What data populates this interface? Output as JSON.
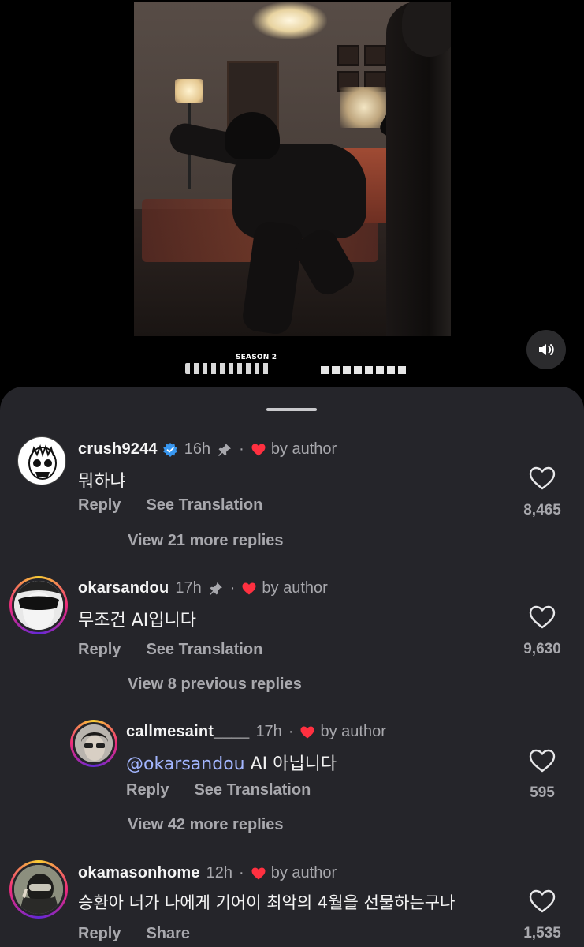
{
  "video": {
    "season_label": "SEASON 2",
    "volume_icon": "speaker-icon"
  },
  "comments": [
    {
      "username": "crush9244",
      "verified": true,
      "time": "16h",
      "pinned": true,
      "separator": "·",
      "by_author": "by author",
      "text": "뭐하냐",
      "reply_label": "Reply",
      "secondary_action": "See Translation",
      "likes": "8,465",
      "view_replies": "View 21 more replies"
    },
    {
      "username": "okarsandou",
      "verified": false,
      "time": "17h",
      "pinned": true,
      "separator": "·",
      "by_author": "by author",
      "text": "무조건 AI입니다",
      "reply_label": "Reply",
      "secondary_action": "See Translation",
      "likes": "9,630",
      "view_previous": "View 8 previous replies",
      "reply": {
        "username": "callmesaint____",
        "time": "17h",
        "separator": "·",
        "by_author": "by author",
        "mention": "@okarsandou",
        "text": " AI 아닙니다",
        "reply_label": "Reply",
        "secondary_action": "See Translation",
        "likes": "595"
      },
      "view_replies": "View 42 more replies"
    },
    {
      "username": "okamasonhome",
      "verified": false,
      "time": "12h",
      "pinned": false,
      "separator": "·",
      "by_author": "by author",
      "text": "승환아 너가 나에게 기어이 최악의 4월을 선물하는구나",
      "reply_label": "Reply",
      "secondary_action": "Share",
      "likes": "1,535"
    }
  ],
  "colors": {
    "sheet_bg": "#25252a",
    "verified_blue": "#3897f0",
    "heart_red": "#ff3040",
    "muted_text": "#a8a8ad",
    "mention": "#a3b6ff"
  }
}
